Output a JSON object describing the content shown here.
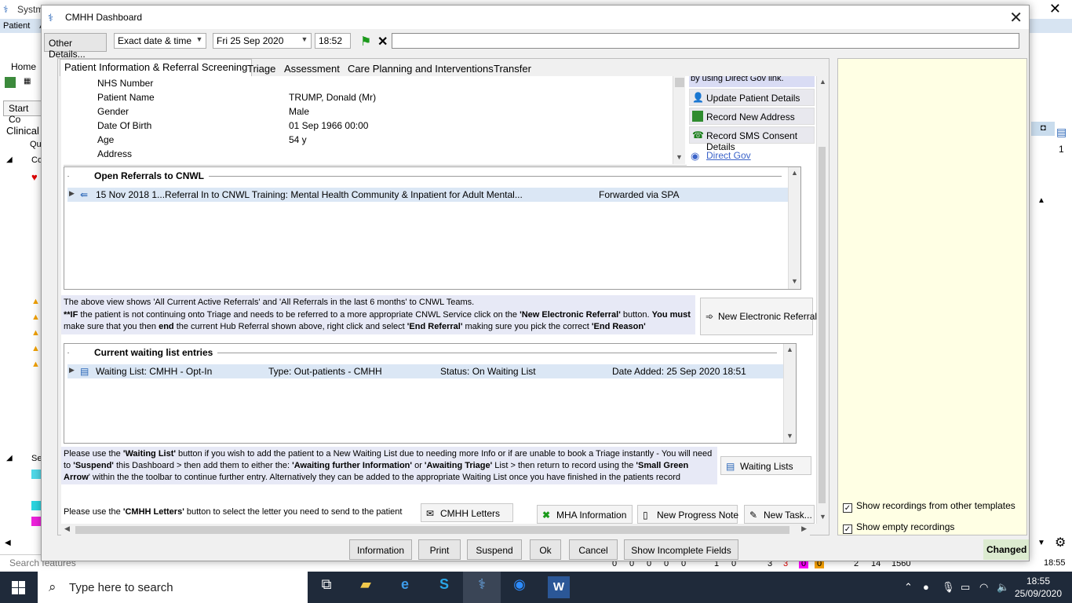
{
  "background": {
    "title": "Systm",
    "menu": [
      "Patient",
      "A"
    ],
    "home": "Home",
    "start": "Start Co",
    "clinical": "Clinical",
    "tree_items": [
      "Qu",
      "Co",
      "Se"
    ],
    "search_placeholder": "Search features",
    "right_count": "1",
    "status_values": [
      "0",
      "0",
      "0",
      "0",
      "0",
      "1",
      "0",
      "3",
      "3",
      "0",
      "0",
      "2",
      "14",
      "1560"
    ],
    "time": "18:55"
  },
  "dialog": {
    "title": "CMHH Dashboard",
    "toolbar": {
      "other_details": "Other Details...",
      "date_mode": "Exact date & time",
      "date": "Fri 25 Sep 2020",
      "time": "18:52",
      "text_value": ""
    },
    "tabs": [
      {
        "label": "Patient Information & Referral Screening",
        "active": true
      },
      {
        "label": "Triage"
      },
      {
        "label": "Assessment"
      },
      {
        "label": "Care Planning and Interventions"
      },
      {
        "label": "Transfer"
      }
    ],
    "patient_info": [
      {
        "label": "NHS Number",
        "value": ""
      },
      {
        "label": "Patient Name",
        "value": "TRUMP, Donald (Mr)"
      },
      {
        "label": "Gender",
        "value": "Male"
      },
      {
        "label": "Date Of Birth",
        "value": "01 Sep 1966 00:00"
      },
      {
        "label": "Age",
        "value": "54 y"
      },
      {
        "label": "Address",
        "value": ""
      }
    ],
    "side_header": "by using Direct Gov link.",
    "side_buttons": [
      {
        "label": "Update Patient Details",
        "icon": "person-icon"
      },
      {
        "label": "Record New Address",
        "icon": "address-icon"
      },
      {
        "label": "Record SMS Consent Details",
        "icon": "phone-icon"
      }
    ],
    "direct_gov": "Direct Gov",
    "open_referrals": {
      "title": "Open Referrals to CNWL",
      "rows": [
        {
          "text": "15 Nov 2018 1...Referral In to CNWL Training: Mental Health Community & Inpatient for Adult Mental...",
          "status": "Forwarded via SPA"
        }
      ]
    },
    "referral_info": {
      "line1": "The above view shows 'All Current Active Referrals' and 'All Referrals in the last 6 months' to CNWL Teams.",
      "line2a": "**IF",
      "line2b": " the patient is not continuing onto Triage and needs to be referred to a more appropriate CNWL Service click on the ",
      "line2c": "'New Electronic Referral'",
      "line2d": " button. ",
      "line2e": "You must",
      "line3a": "make sure that you then ",
      "line3b": "end",
      "line3c": " the current Hub Referral shown above, right click and select ",
      "line3d": "'End Referral'",
      "line3e": " making sure you pick the correct ",
      "line3f": "'End Reason'"
    },
    "new_referral_button": "New Electronic Referral",
    "waiting_list": {
      "title": "Current waiting list entries",
      "rows": [
        {
          "name": "Waiting List: CMHH - Opt-In",
          "type": "Type: Out-patients - CMHH",
          "status": "Status: On Waiting List",
          "added": "Date Added: 25 Sep 2020 18:51"
        }
      ]
    },
    "waiting_info": {
      "l1a": "Please use the ",
      "l1b": "'Waiting List'",
      "l1c": " button if you wish to add the patient to a New Waiting List due to needing more Info or if are unable to book a Triage instantly - You will need",
      "l2a": "to ",
      "l2b": "'Suspend'",
      "l2c": " this Dashboard > then add them to either the: ",
      "l2d": "'Awaiting further Information'",
      "l2e": " or  ",
      "l2f": "'Awaiting Triage'",
      "l2g": " List > then return to record using the ",
      "l2h": "'Small Green",
      "l3a": "Arrow",
      "l3b": "' within the the toolbar to continue further entry. Alternatively they can be added to the appropriate Waiting List once you have finished in the patients record"
    },
    "waiting_lists_button": "Waiting Lists",
    "letters_info": {
      "a": "Please use the ",
      "b": "'CMHH Letters'",
      "c": " button to select the letter you need to send to the patient"
    },
    "cmhh_letters_button": "CMHH Letters",
    "mha_button": "MHA Information",
    "progress_note_button": "New Progress Note",
    "new_task_button": "New Task...",
    "checkboxes": [
      {
        "label": "Show recordings from other templates",
        "checked": true
      },
      {
        "label": "Show empty recordings",
        "checked": true
      }
    ],
    "bottom_buttons": [
      "Information",
      "Print",
      "Suspend",
      "Ok",
      "Cancel",
      "Show Incomplete Fields"
    ],
    "changed": "Changed"
  },
  "taskbar": {
    "search_placeholder": "Type here to search",
    "time": "18:55",
    "date": "25/09/2020"
  },
  "colors": {
    "accent": "#3b63c9",
    "notes_bg": "#ffffe4",
    "taskbar": "#1f2a3a",
    "selected_row": "#dbe7f5"
  }
}
